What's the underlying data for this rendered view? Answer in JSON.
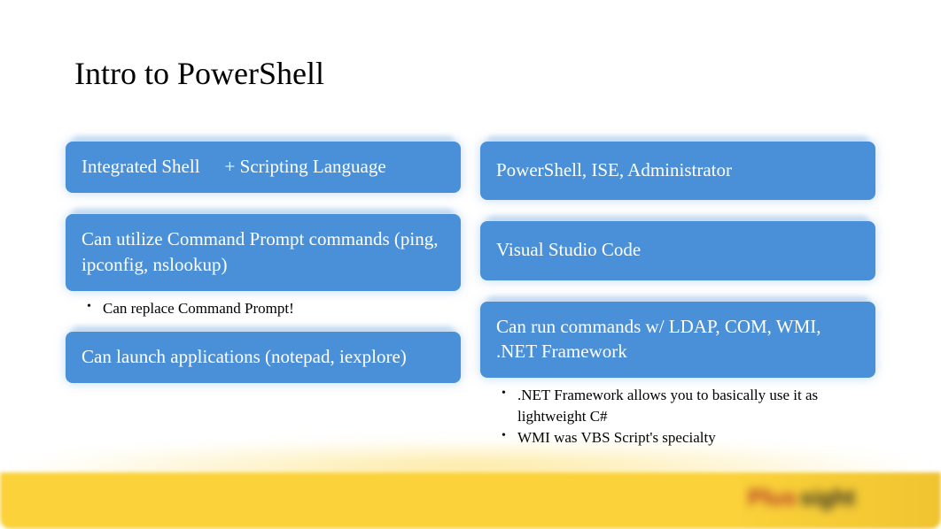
{
  "title": "Intro to PowerShell",
  "left": {
    "card1a": "Integrated Shell",
    "card1b": "+ Scripting Language",
    "card2": "Can utilize Command Prompt commands (ping, ipconfig, nslookup)",
    "bullet2a": "Can replace Command Prompt!",
    "card3": "Can launch applications (notepad, iexplore)"
  },
  "right": {
    "card1": "PowerShell, ISE, Administrator",
    "card2": "Visual Studio Code",
    "card3": "Can run commands w/ LDAP, COM, WMI, .NET Framework",
    "bullet3a": ".NET Framework allows you to basically use it as lightweight C#",
    "bullet3b": "WMI was VBS Script's specialty"
  },
  "footer": {
    "logo_red": "Plus",
    "logo_dark": "sight"
  }
}
